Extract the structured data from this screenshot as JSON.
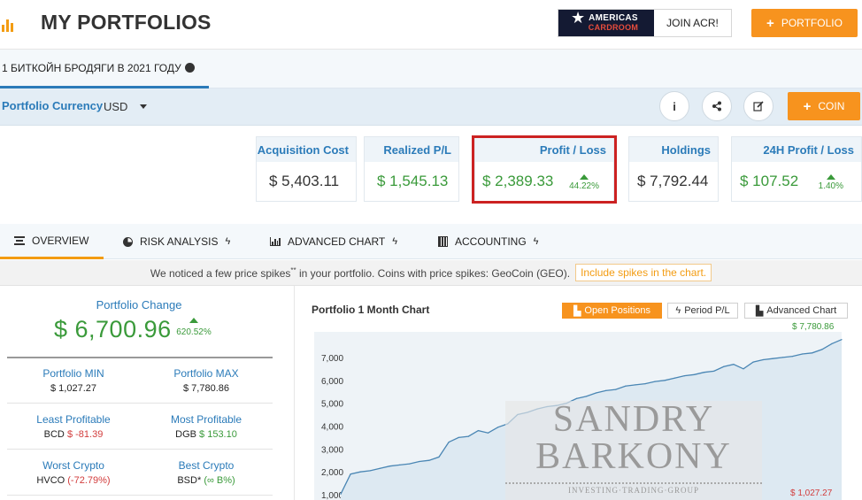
{
  "header": {
    "title": "MY PORTFOLIOS",
    "acr_logo_line1": "AMERICAS",
    "acr_logo_line2": "CARDROOM",
    "acr_join": "JOIN ACR!",
    "portfolio_button": "PORTFOLIO"
  },
  "portfolio_tab": {
    "label": "1 БИТКОЙН БРОДЯГИ В 2021 ГОДУ"
  },
  "currency": {
    "label": "Portfolio Currency",
    "value": "USD"
  },
  "actions": {
    "info_icon": "i",
    "coin_button": "COIN"
  },
  "cards": [
    {
      "title": "Acquisition Cost",
      "value": "$ 5,403.11",
      "pct": ""
    },
    {
      "title": "Realized P/L",
      "value": "$ 1,545.13",
      "pct": ""
    },
    {
      "title": "Profit / Loss",
      "value": "$ 2,389.33",
      "pct": "44.22%"
    },
    {
      "title": "Holdings",
      "value": "$ 7,792.44",
      "pct": ""
    },
    {
      "title": "24H Profit / Loss",
      "value": "$ 107.52",
      "pct": "1.40%"
    }
  ],
  "nav": {
    "overview": "OVERVIEW",
    "risk": "RISK ANALYSIS",
    "advanced": "ADVANCED CHART",
    "accounting": "ACCOUNTING"
  },
  "notice": {
    "text_before": "We noticed a few price spikes",
    "sup": "**",
    "text_after": " in your portfolio. Coins with price spikes: GeoCoin (GEO).",
    "link": "Include spikes in the chart."
  },
  "summary": {
    "change_label": "Portfolio Change",
    "change_value": "$ 6,700.96",
    "change_pct": "620.52%",
    "min_label": "Portfolio MIN",
    "min_value": "$ 1,027.27",
    "max_label": "Portfolio MAX",
    "max_value": "$ 7,780.86",
    "least_label": "Least Profitable",
    "least_coin": "BCD",
    "least_value": "$ -81.39",
    "most_label": "Most Profitable",
    "most_coin": "DGB",
    "most_value": "$ 153.10",
    "worst_label": "Worst Crypto",
    "worst_coin": "HVCO",
    "worst_value": "(-72.79%)",
    "best_label": "Best Crypto",
    "best_coin": "BSD*",
    "best_value": "(∞ B%)"
  },
  "chart_panel": {
    "title": "Portfolio 1 Month Chart",
    "btn_open": "Open Positions",
    "btn_period": "Period P/L",
    "btn_advanced": "Advanced Chart",
    "max_label": "$ 7,780.86",
    "min_label": "$ 1,027.27"
  },
  "watermark": {
    "line1": "SANDRY",
    "line2": "BARKONY",
    "line3": "INVESTING·TRADING·GROUP"
  },
  "chart_data": {
    "type": "area",
    "title": "Portfolio 1 Month Chart",
    "xlabel": "",
    "ylabel": "",
    "ylim": [
      1000,
      7500
    ],
    "y_ticks": [
      "1,000",
      "2,000",
      "3,000",
      "4,000",
      "5,000",
      "6,000",
      "7,000"
    ],
    "values": [
      1027,
      1900,
      2000,
      2050,
      2150,
      2250,
      2300,
      2350,
      2450,
      2500,
      2650,
      3300,
      3500,
      3550,
      3800,
      3700,
      3950,
      4100,
      4500,
      4600,
      4750,
      4850,
      4900,
      5000,
      5200,
      5300,
      5450,
      5550,
      5600,
      5750,
      5800,
      5850,
      5950,
      6000,
      6100,
      6200,
      6250,
      6350,
      6400,
      6600,
      6700,
      6500,
      6800,
      6900,
      6950,
      7000,
      7050,
      7150,
      7200,
      7350,
      7600,
      7781
    ],
    "grid": false,
    "fill_color": "#dde9f2",
    "line_color": "#4a86b4"
  },
  "colors": {
    "accent": "#f7931e",
    "blue": "#2b7bb9",
    "green": "#3a9a3a",
    "red": "#d23c3c"
  }
}
